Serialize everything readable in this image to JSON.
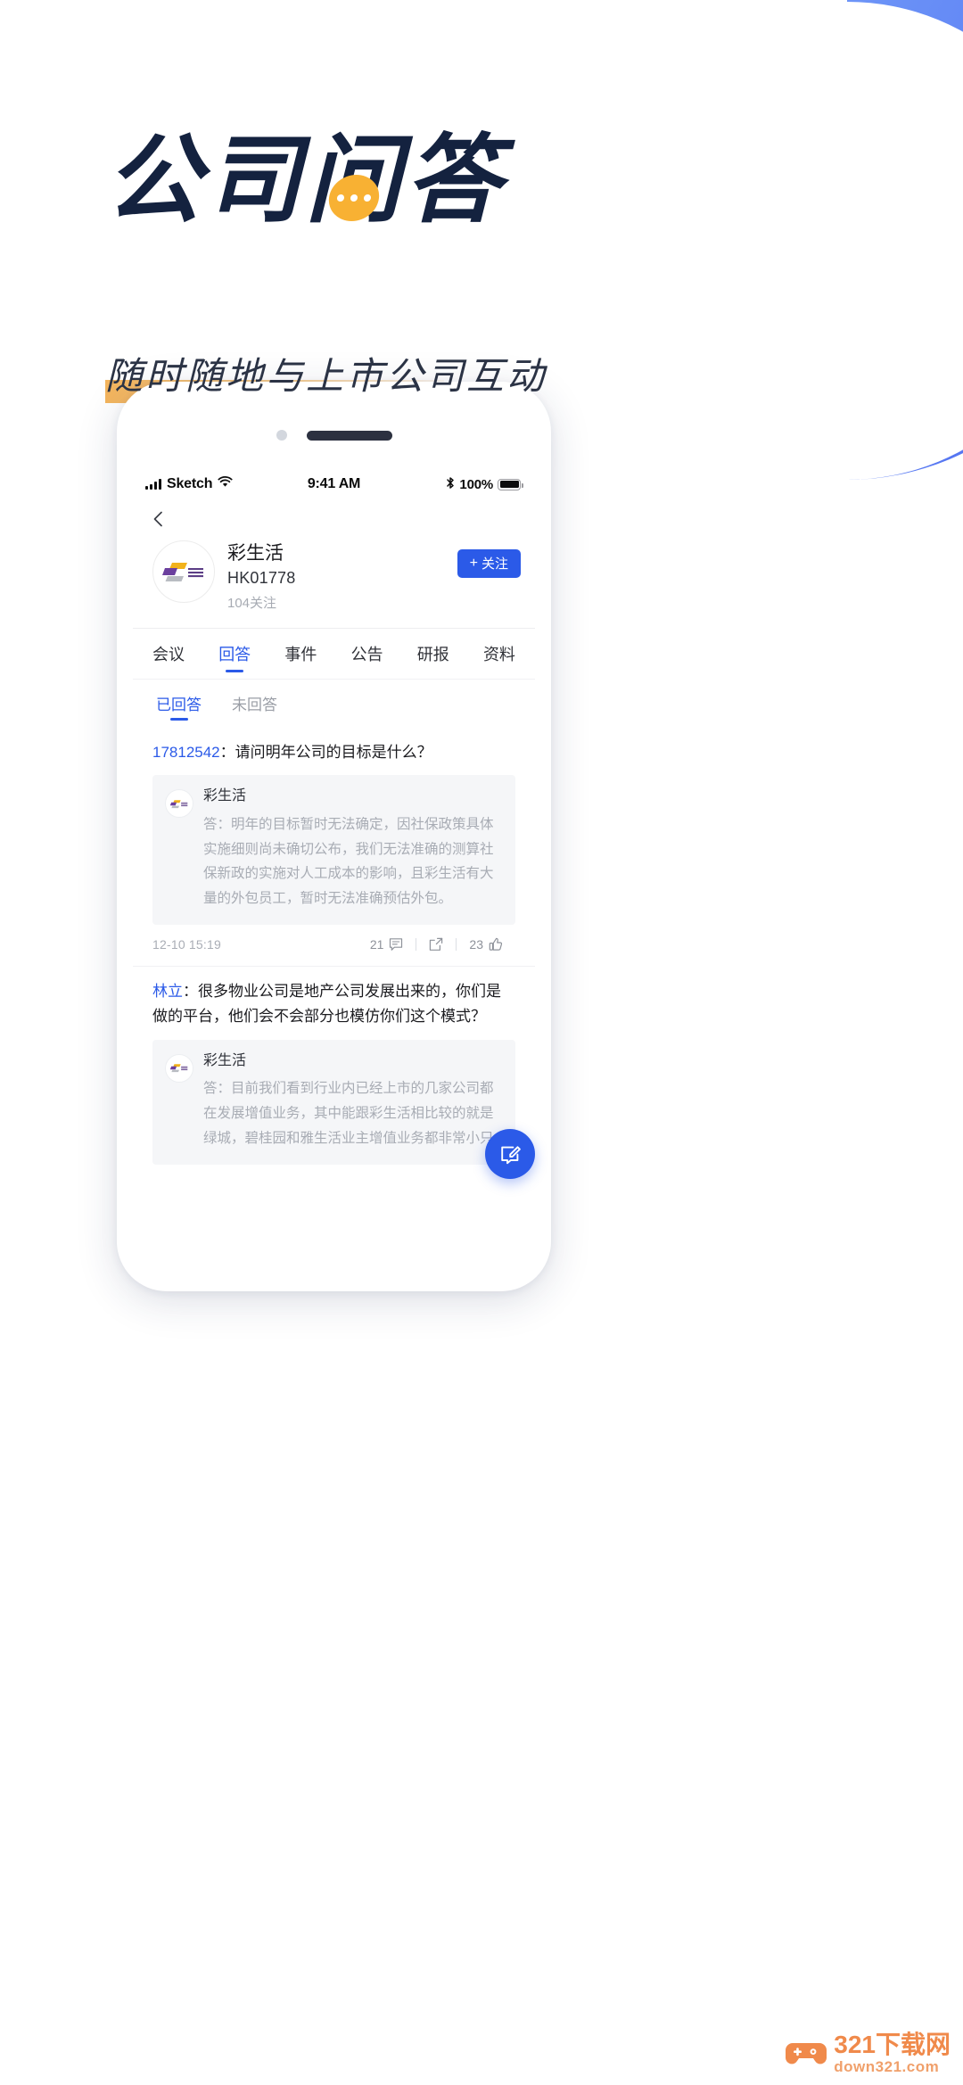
{
  "theme": {
    "brand_blue": "#2b5ae8",
    "arc_blue": "#5b85f5",
    "hero_navy": "#14223f",
    "accent_orange": "#f8b133",
    "card_gray": "#f5f6f8",
    "muted_text": "#a8acb4"
  },
  "hero": {
    "title_chars": [
      "公",
      "司",
      "问",
      "答"
    ],
    "subtitle": "随时随地与上市公司互动"
  },
  "phone": {
    "statusbar": {
      "carrier": "Sketch",
      "time": "9:41 AM",
      "battery_percent": "100%",
      "signal_icon": "signal-bars-icon",
      "wifi_icon": "wifi-icon",
      "bluetooth_icon": "bluetooth-icon",
      "battery_icon": "battery-full-icon"
    },
    "navbar": {
      "back_icon": "back-chevron-icon"
    },
    "company": {
      "logo_icon": "company-logo-icon",
      "name": "彩生活",
      "code": "HK01778",
      "followers": "104关注",
      "follow_button": {
        "plus": "+",
        "label": "关注"
      }
    },
    "tabs": [
      {
        "label": "会议",
        "active": false
      },
      {
        "label": "回答",
        "active": true
      },
      {
        "label": "事件",
        "active": false
      },
      {
        "label": "公告",
        "active": false
      },
      {
        "label": "研报",
        "active": false
      },
      {
        "label": "资料",
        "active": false
      }
    ],
    "subtabs": [
      {
        "label": "已回答",
        "active": true
      },
      {
        "label": "未回答",
        "active": false
      }
    ],
    "feed": [
      {
        "asker": "17812542",
        "separator": "：",
        "question": "请问明年公司的目标是什么？",
        "answer": {
          "author": "彩生活",
          "text": "答：明年的目标暂时无法确定，因社保政策具体实施细则尚未确切公布，我们无法准确的测算社保新政的实施对人工成本的影响，且彩生活有大量的外包员工，暂时无法准确预估外包。"
        },
        "meta": {
          "time": "12-10 15:19",
          "comment_count": "21",
          "comment_icon": "comment-icon",
          "share_icon": "share-icon",
          "like_count": "23",
          "like_icon": "thumbs-up-icon"
        }
      },
      {
        "asker": "林立",
        "separator": "：",
        "question": "很多物业公司是地产公司发展出来的，你们是做的平台，他们会不会部分也模仿你们这个模式？",
        "answer": {
          "author": "彩生活",
          "text": "答：目前我们看到行业内已经上市的几家公司都在发展增值业务，其中能跟彩生活相比较的就是绿城，碧桂园和雅生活业主增值业务都非常小只"
        }
      }
    ],
    "fab": {
      "icon": "write-question-icon"
    }
  },
  "watermark": {
    "icon": "gamepad-icon",
    "title": "321下载网",
    "url": "down321.com"
  }
}
